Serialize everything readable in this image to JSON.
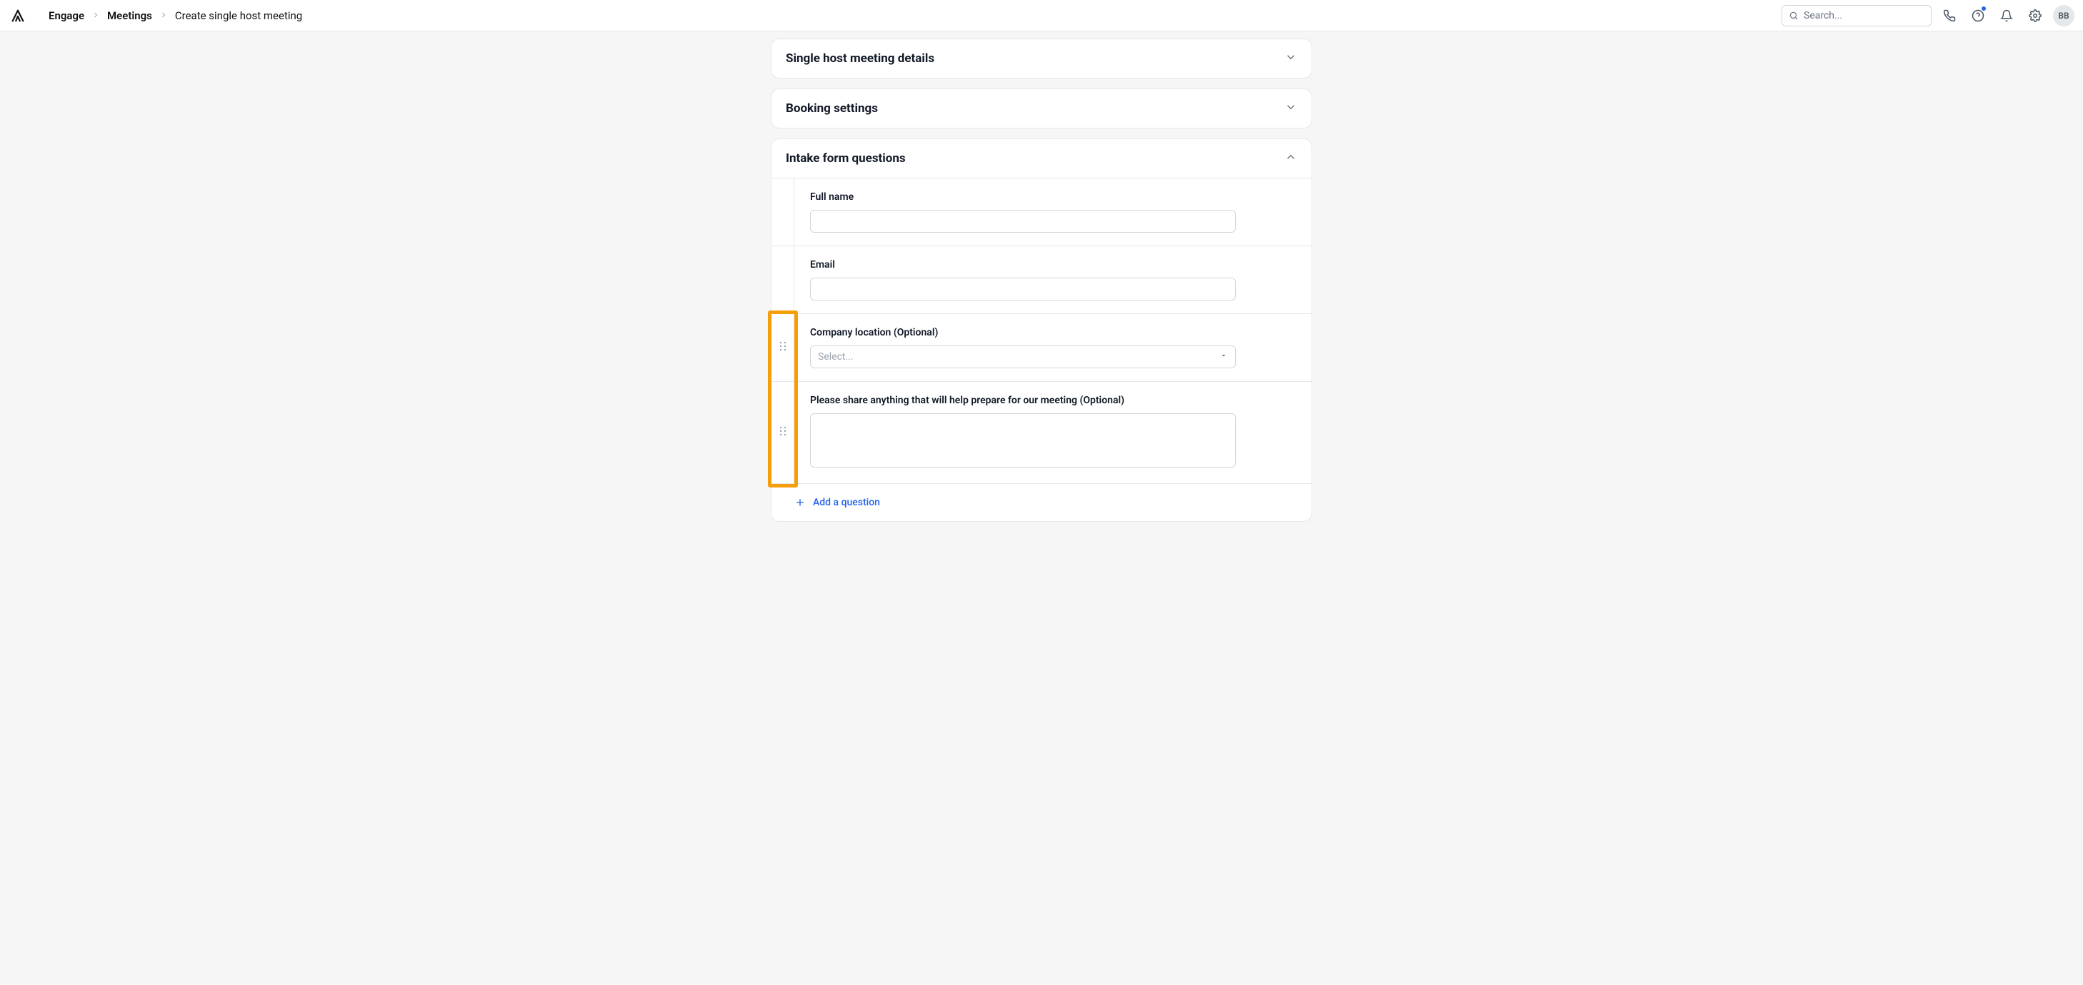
{
  "header": {
    "search_placeholder": "Search...",
    "avatar_initials": "BB"
  },
  "breadcrumb": {
    "items": [
      "Engage",
      "Meetings",
      "Create single host meeting"
    ]
  },
  "sections": {
    "details_title": "Single host meeting details",
    "booking_title": "Booking settings",
    "intake_title": "Intake form questions"
  },
  "questions": [
    {
      "label": "Full name",
      "type": "text",
      "draggable": false
    },
    {
      "label": "Email",
      "type": "text",
      "draggable": false
    },
    {
      "label": "Company location (Optional)",
      "type": "select",
      "placeholder": "Select...",
      "draggable": true
    },
    {
      "label": "Please share anything that will help prepare for our meeting (Optional)",
      "type": "textarea",
      "draggable": true
    }
  ],
  "actions": {
    "add_question": "Add a question"
  }
}
